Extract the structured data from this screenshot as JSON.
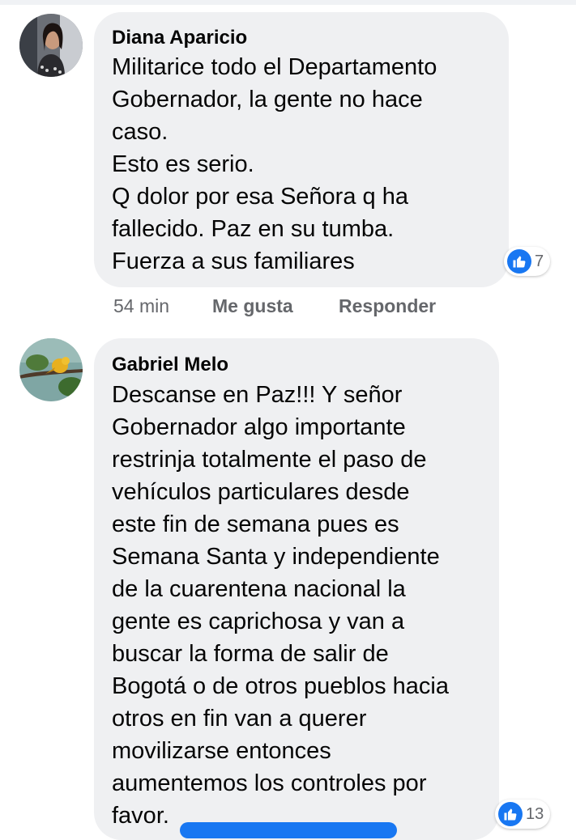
{
  "comments": [
    {
      "author": "Diana Aparicio",
      "lines": [
        "Militarice todo el Departamento",
        "Gobernador, la gente no hace",
        "caso.",
        "Esto es serio.",
        "Q dolor por esa Señora q ha",
        "fallecido. Paz en su tumba.",
        "Fuerza a sus familiares"
      ],
      "reaction_icon": "like-icon",
      "reaction_count": "7",
      "time": "54 min",
      "like_label": "Me gusta",
      "reply_label": "Responder"
    },
    {
      "author": "Gabriel Melo",
      "lines": [
        "Descanse en Paz!!! Y señor",
        "Gobernador algo importante",
        "restrinja totalmente el paso de",
        "vehículos particulares desde",
        "este fin de semana pues es",
        "Semana Santa y independiente",
        "de la cuarentena nacional la",
        "gente es caprichosa y van a",
        "buscar la forma de salir de",
        "Bogotá o de otros pueblos hacia",
        "otros en fin van a querer",
        "movilizarse entonces",
        "aumentemos los controles por",
        "favor."
      ],
      "reaction_icon": "like-icon",
      "reaction_count": "13"
    }
  ],
  "colors": {
    "bubble": "#eff0f2",
    "meta_text": "#65676b",
    "like_blue": "#1877f2"
  }
}
